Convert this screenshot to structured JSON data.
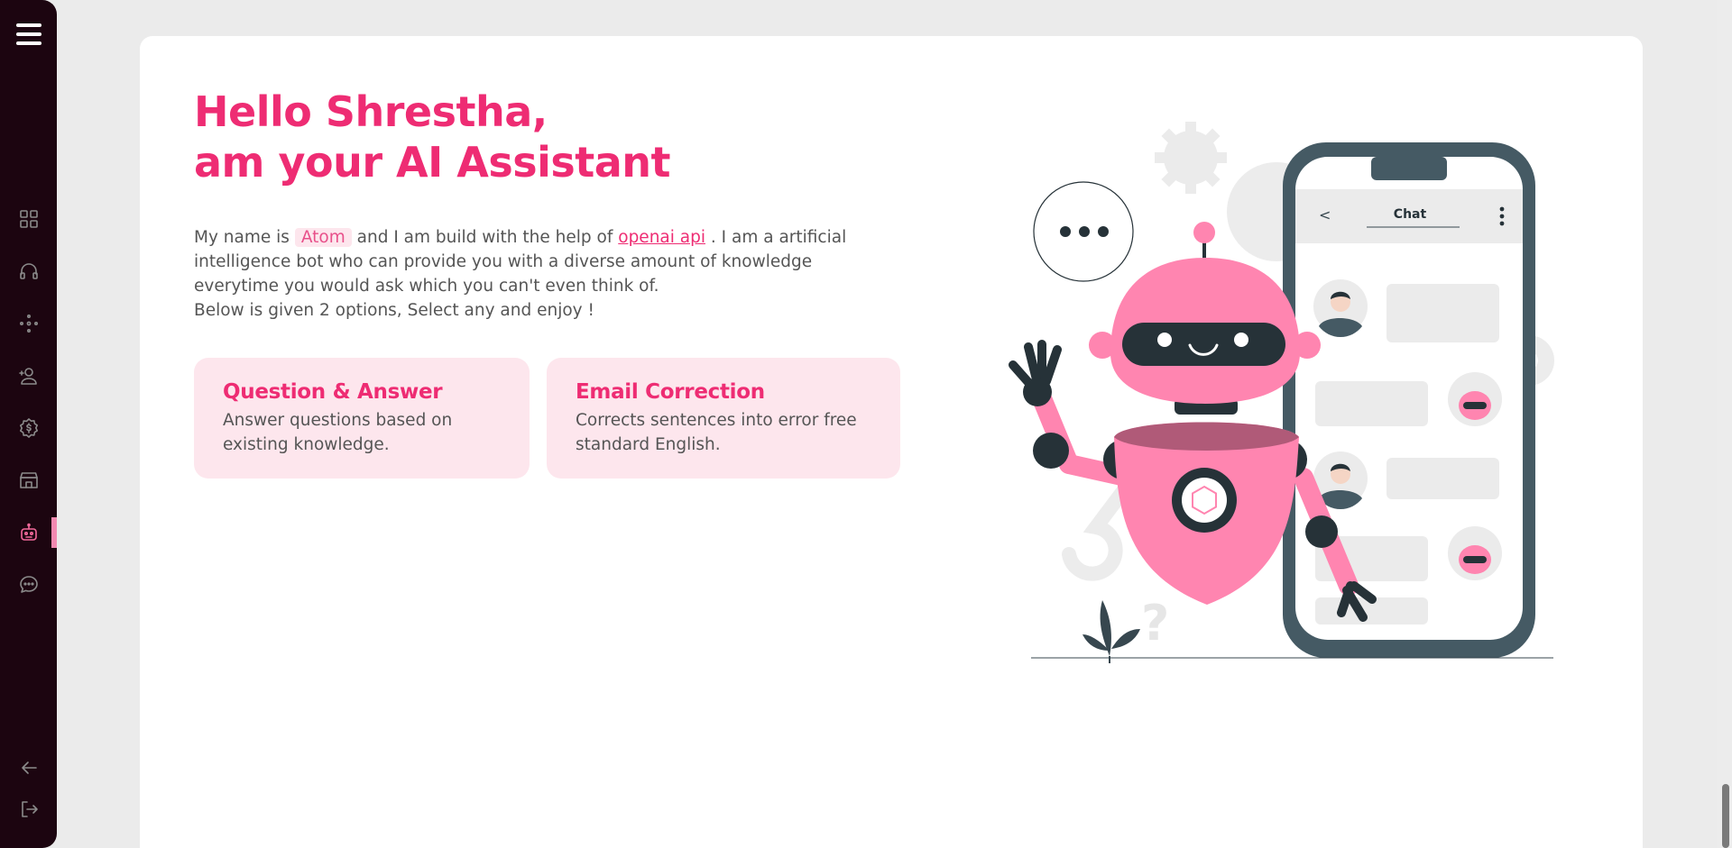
{
  "sidebar": {
    "items": [
      {
        "name": "dashboard",
        "icon": "grid-icon"
      },
      {
        "name": "support",
        "icon": "headphones-icon"
      },
      {
        "name": "connections",
        "icon": "dots-network-icon"
      },
      {
        "name": "users",
        "icon": "user-add-icon"
      },
      {
        "name": "billing",
        "icon": "dollar-gear-icon"
      },
      {
        "name": "store",
        "icon": "store-icon"
      },
      {
        "name": "ai-assistant",
        "icon": "robot-icon",
        "active": true
      },
      {
        "name": "chat",
        "icon": "chat-bubble-icon"
      }
    ],
    "bottom": [
      {
        "name": "back",
        "icon": "arrow-left-icon"
      },
      {
        "name": "logout",
        "icon": "logout-icon"
      }
    ]
  },
  "main": {
    "heading_line1": "Hello Shrestha,",
    "heading_line2": "am your AI Assistant",
    "desc_part1": "My name is",
    "bot_name": "Atom",
    "desc_part2": "and I am build with the help of",
    "api_link": "openai api",
    "desc_part3": ". I am a artificial intelligence bot who can provide you with a diverse amount of knowledge everytime you would ask which you can't even think of.",
    "desc_line2": "Below is given 2 options, Select any and enjoy !",
    "options": [
      {
        "title": "Question & Answer",
        "description": "Answer questions based on existing knowledge."
      },
      {
        "title": "Email Correction",
        "description": "Corrects sentences into error free standard English."
      }
    ]
  },
  "illustration": {
    "phone_header": "Chat",
    "back_glyph": "<",
    "question_mark": "?"
  },
  "colors": {
    "accent": "#ee2c73",
    "sidebar_bg": "#1c0510",
    "card_bg": "#fde6ed",
    "robot_pink": "#ff85b0",
    "dark": "#37474f"
  }
}
